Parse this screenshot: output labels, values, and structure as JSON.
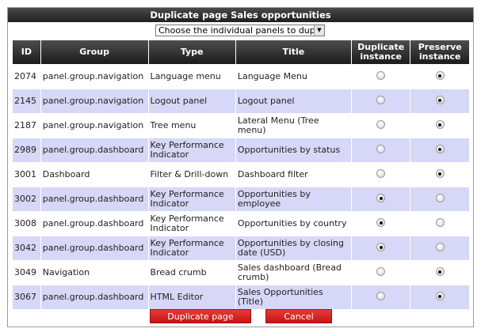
{
  "dialog": {
    "title": "Duplicate page Sales opportunities",
    "select": {
      "value": "Choose the individual panels to dupl"
    }
  },
  "table": {
    "headers": [
      "ID",
      "Group",
      "Type",
      "Title",
      "Duplicate instance",
      "Preserve instance"
    ],
    "rows": [
      {
        "id": "2074",
        "group": "panel.group.navigation",
        "type": "Language menu",
        "title": "Language Menu",
        "duplicate": false,
        "preserve": true
      },
      {
        "id": "2145",
        "group": "panel.group.navigation",
        "type": "Logout panel",
        "title": "Logout panel",
        "duplicate": false,
        "preserve": true
      },
      {
        "id": "2187",
        "group": "panel.group.navigation",
        "type": "Tree menu",
        "title": "Lateral Menu (Tree menu)",
        "duplicate": false,
        "preserve": true
      },
      {
        "id": "2989",
        "group": "panel.group.dashboard",
        "type": "Key Performance Indicator",
        "title": "Opportunities by status",
        "duplicate": false,
        "preserve": true
      },
      {
        "id": "3001",
        "group": "Dashboard",
        "type": "Filter & Drill-down",
        "title": "Dashboard filter",
        "duplicate": false,
        "preserve": true
      },
      {
        "id": "3002",
        "group": "panel.group.dashboard",
        "type": "Key Performance Indicator",
        "title": "Opportunities by employee",
        "duplicate": true,
        "preserve": false
      },
      {
        "id": "3008",
        "group": "panel.group.dashboard",
        "type": "Key Performance Indicator",
        "title": "Opportunities by country",
        "duplicate": true,
        "preserve": false
      },
      {
        "id": "3042",
        "group": "panel.group.dashboard",
        "type": "Key Performance Indicator",
        "title": "Opportunities by closing date (USD)",
        "duplicate": true,
        "preserve": false
      },
      {
        "id": "3049",
        "group": "Navigation",
        "type": "Bread crumb",
        "title": "Sales dashboard (Bread crumb)",
        "duplicate": false,
        "preserve": true
      },
      {
        "id": "3067",
        "group": "panel.group.dashboard",
        "type": "HTML Editor",
        "title": "Sales Opportunities (Title)",
        "duplicate": false,
        "preserve": true
      }
    ]
  },
  "buttons": {
    "duplicate": "Duplicate page",
    "cancel": "Cancel"
  }
}
